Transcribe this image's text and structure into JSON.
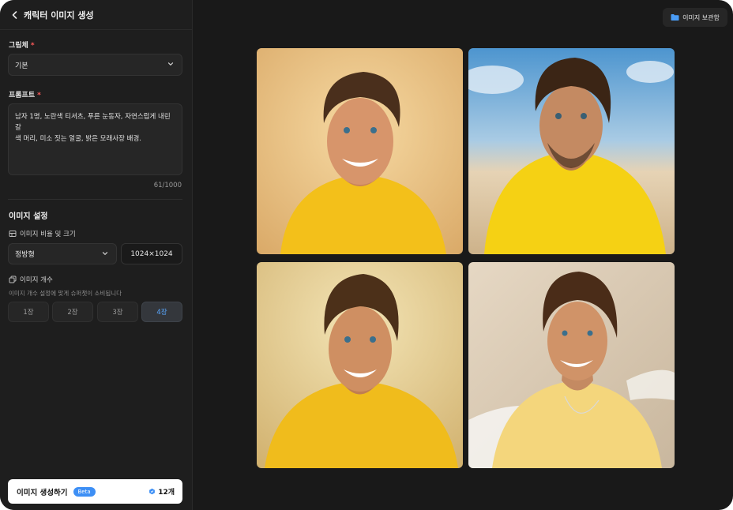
{
  "header": {
    "title": "캐릭터 이미지 생성",
    "back_icon": "chevron-left-icon"
  },
  "style_field": {
    "label": "그림체",
    "required_mark": "*",
    "value": "기본"
  },
  "prompt_field": {
    "label": "프롬프트",
    "required_mark": "*",
    "value_line1": "남자 1명, 노란색 티셔츠, 푸른 눈동자, 자연스럽게 내린 갈",
    "value_line2": "색 머리, 미소 짓는 얼굴, 밝은 모래사장 배경.",
    "counter": "61/1000"
  },
  "image_settings": {
    "title": "이미지 설정",
    "ratio_label": "이미지 비율 및 크기",
    "ratio_value": "정방형",
    "size_value": "1024×1024",
    "count_label": "이미지 개수",
    "count_hint": "이미지 개수 설정에 맞게 슈퍼챗이 소비됩니다",
    "count_options": [
      "1장",
      "2장",
      "3장",
      "4장"
    ],
    "count_selected": "4장"
  },
  "generate": {
    "label": "이미지 생성하기",
    "badge": "Beta",
    "credits": "12개"
  },
  "toolbar": {
    "storage_label": "이미지 보관함",
    "storage_icon": "folder-icon"
  },
  "colors": {
    "accent": "#3d8ff5",
    "background": "#191919",
    "sidebar": "#1e1e1e",
    "required": "#ff5a5a"
  }
}
